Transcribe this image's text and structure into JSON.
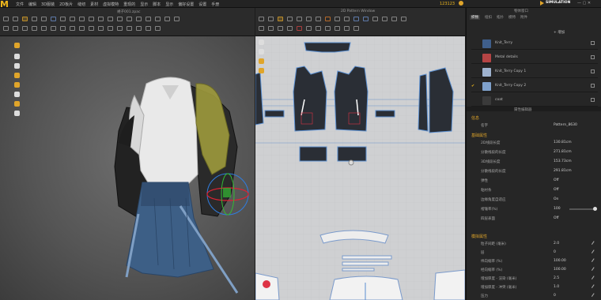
{
  "app": {
    "logo": "M",
    "user_id": "123123",
    "sim_label": "SIMULATION",
    "panel_title": "物体窗口"
  },
  "menus": [
    "文件",
    "编辑",
    "3D服装",
    "2D板片",
    "缝纫",
    "素材",
    "虚拟模特",
    "重现的",
    "显示",
    "脚本",
    "显示",
    "偏好设置",
    "设置",
    "手册"
  ],
  "windows": {
    "view3d_title": "裙子001.zpac",
    "view2d_title": "2D Pattern Window"
  },
  "panel_tabs": [
    "织物",
    "纽扣",
    "拓扑",
    "模特",
    "附件"
  ],
  "panel_add": "+ 增加",
  "materials": [
    {
      "name": "Knit_Terry",
      "color": "#3f5f8c",
      "checked": false
    },
    {
      "name": "Metal details",
      "color": "#b54444",
      "checked": false
    },
    {
      "name": "Knit_Terry Copy 1",
      "color": "#9fb3cf",
      "checked": false
    },
    {
      "name": "Knit_Terry Copy 2",
      "color": "#7fa1cc",
      "checked": true
    },
    {
      "name": "coat",
      "color": "#3a3a3a",
      "checked": false
    }
  ],
  "inspector": {
    "header": "属性编辑器",
    "sections": {
      "info": "信息",
      "basic": "基础属性",
      "sim": "模拟属性"
    },
    "name_label": "名字",
    "name_value": "Pattern_8630",
    "rows": [
      {
        "k": "2D线段长度",
        "v": "130.81cm"
      },
      {
        "k": "分散线段的长度",
        "v": "271.81cm"
      },
      {
        "k": "3D线段长度",
        "v": "153.73cm"
      },
      {
        "k": "分散线段的长度",
        "v": "291.81cm"
      },
      {
        "k": "弹性",
        "v": "Off"
      },
      {
        "k": "粘衬条",
        "v": "Off"
      },
      {
        "k": "边缘角度自适应",
        "v": "On"
      },
      {
        "k": "褶皱率(%)",
        "v": "100"
      },
      {
        "k": "四层表面",
        "v": "Off"
      }
    ],
    "sim_rows": [
      {
        "k": "粒子间距 (毫米)",
        "v": "2.0"
      },
      {
        "k": "层",
        "v": "0"
      },
      {
        "k": "纬向缩率 (%)",
        "v": "100.00"
      },
      {
        "k": "经向缩率 (%)",
        "v": "100.00"
      },
      {
        "k": "增加厚度 - 渲染 (毫米)",
        "v": "2.5"
      },
      {
        "k": "增加厚度 - 冲突 (毫米)",
        "v": "1.0"
      },
      {
        "k": "压力",
        "v": "0"
      }
    ]
  }
}
